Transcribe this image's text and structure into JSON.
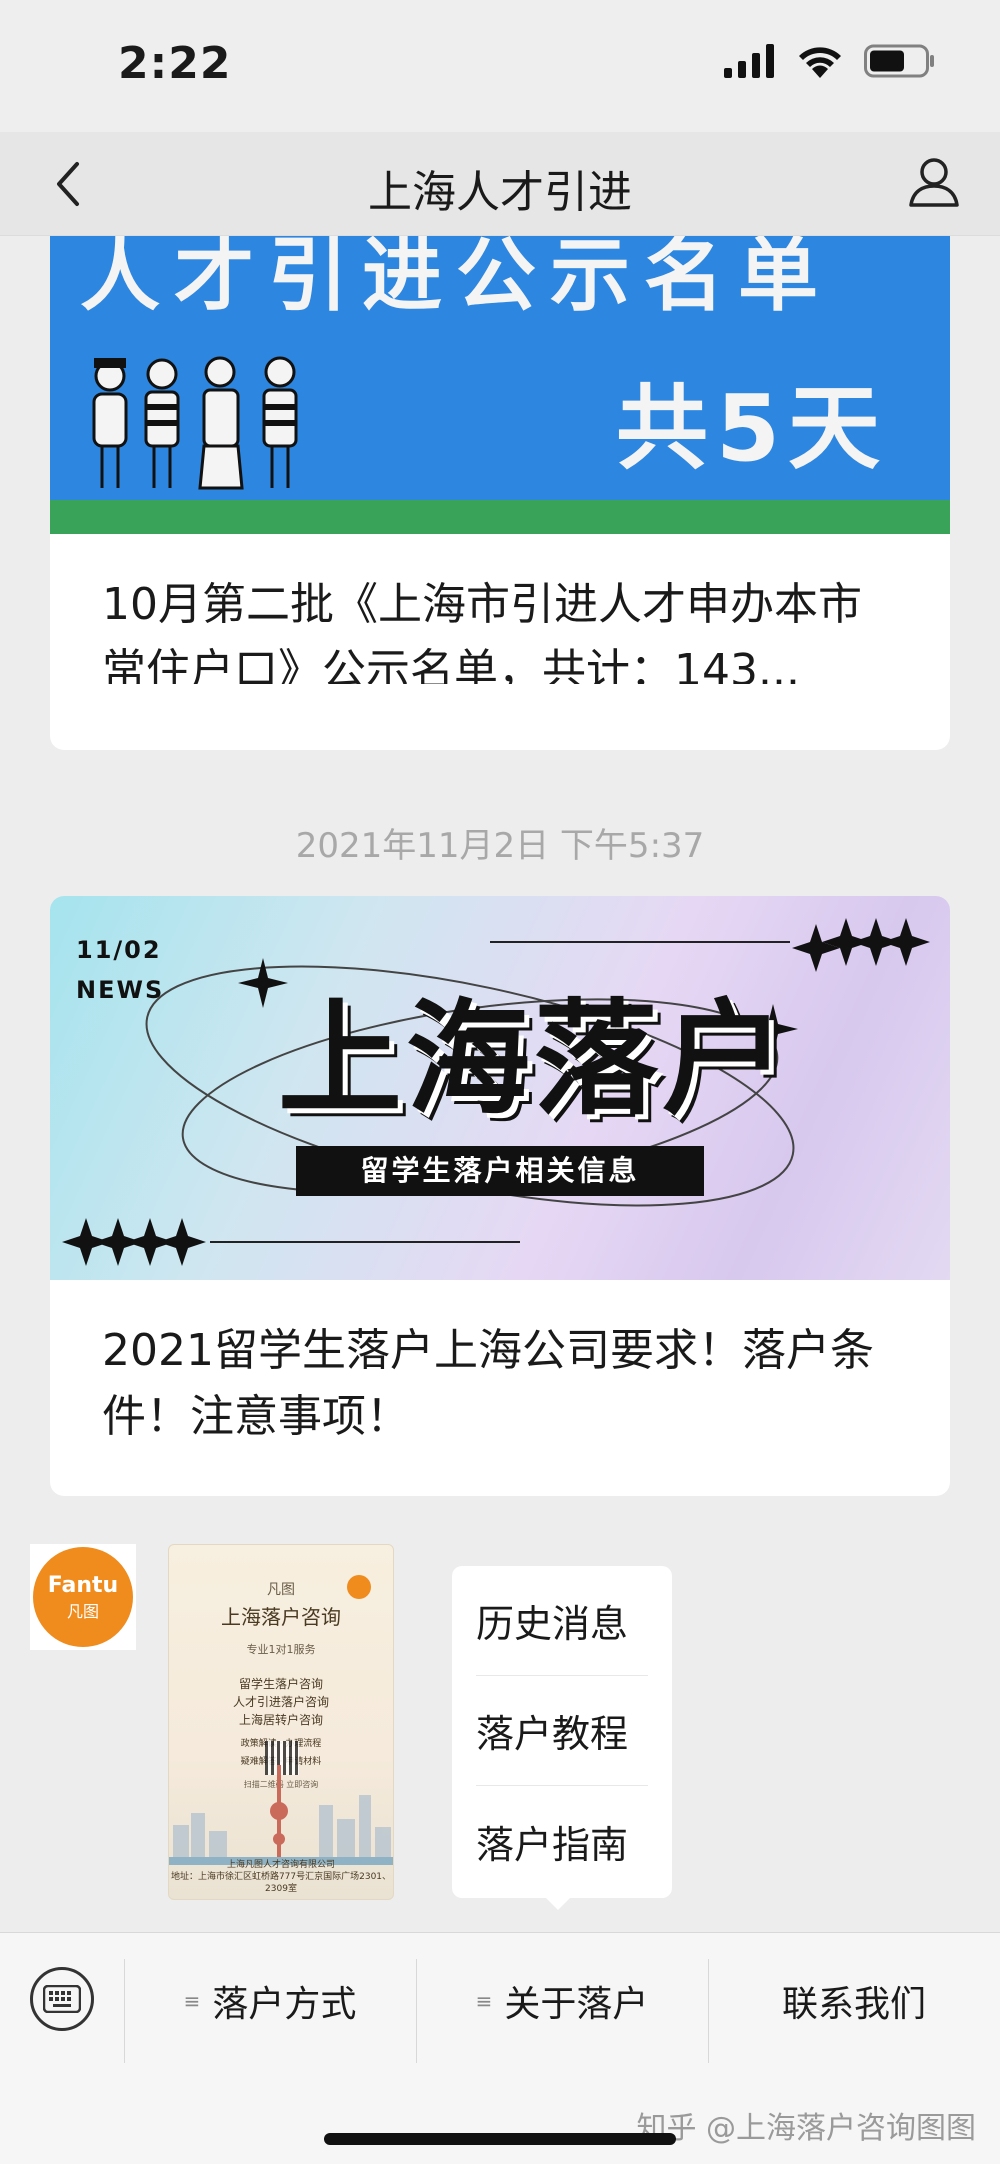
{
  "status_bar": {
    "time": "2:22",
    "icons": [
      "signal-icon",
      "wifi-icon",
      "battery-icon"
    ]
  },
  "nav": {
    "title": "上海人才引进",
    "back_icon": "chevron-left-icon",
    "profile_icon": "person-icon"
  },
  "articles": [
    {
      "banner_line1": "人才引进公示名单",
      "banner_line2": "共5天",
      "title": "10月第二批《上海市引进人才申办本市常住户口》公示名单，共计：143..."
    },
    {
      "banner_date": "11/02",
      "banner_news": "NEWS",
      "banner_title": "上海落户",
      "banner_subtitle": "留学生落户相关信息",
      "title": "2021留学生落户上海公司要求！落户条件！注意事项！"
    }
  ],
  "date_stamp": "2021年11月2日 下午5:37",
  "avatar": {
    "brand_text": "Fantu",
    "brand_sub": "凡图"
  },
  "poster": {
    "brand": "凡图",
    "heading": "上海落户咨询",
    "tagline": "专业1对1服务",
    "lines": [
      "留学生落户咨询",
      "人才引进落户咨询",
      "上海居转户咨询"
    ],
    "features": [
      "政策解读",
      "办理流程",
      "疑难解答",
      "申请材料"
    ],
    "qr_caption": "扫描二维码 立即咨询",
    "footer_company": "上海凡图人才咨询有限公司",
    "footer_address": "地址：上海市徐汇区虹桥路777号汇京国际广场2301、2309室"
  },
  "popup_menu": {
    "items": [
      "历史消息",
      "落户教程",
      "落户指南"
    ]
  },
  "bottom_bar": {
    "keyboard_icon": "keyboard-icon",
    "items": [
      {
        "label": "落户方式",
        "has_menu": true
      },
      {
        "label": "关于落户",
        "has_menu": true
      },
      {
        "label": "联系我们",
        "has_menu": false
      }
    ],
    "menu_glyph": "≡"
  },
  "watermark": "知乎 @上海落户咨询图图"
}
